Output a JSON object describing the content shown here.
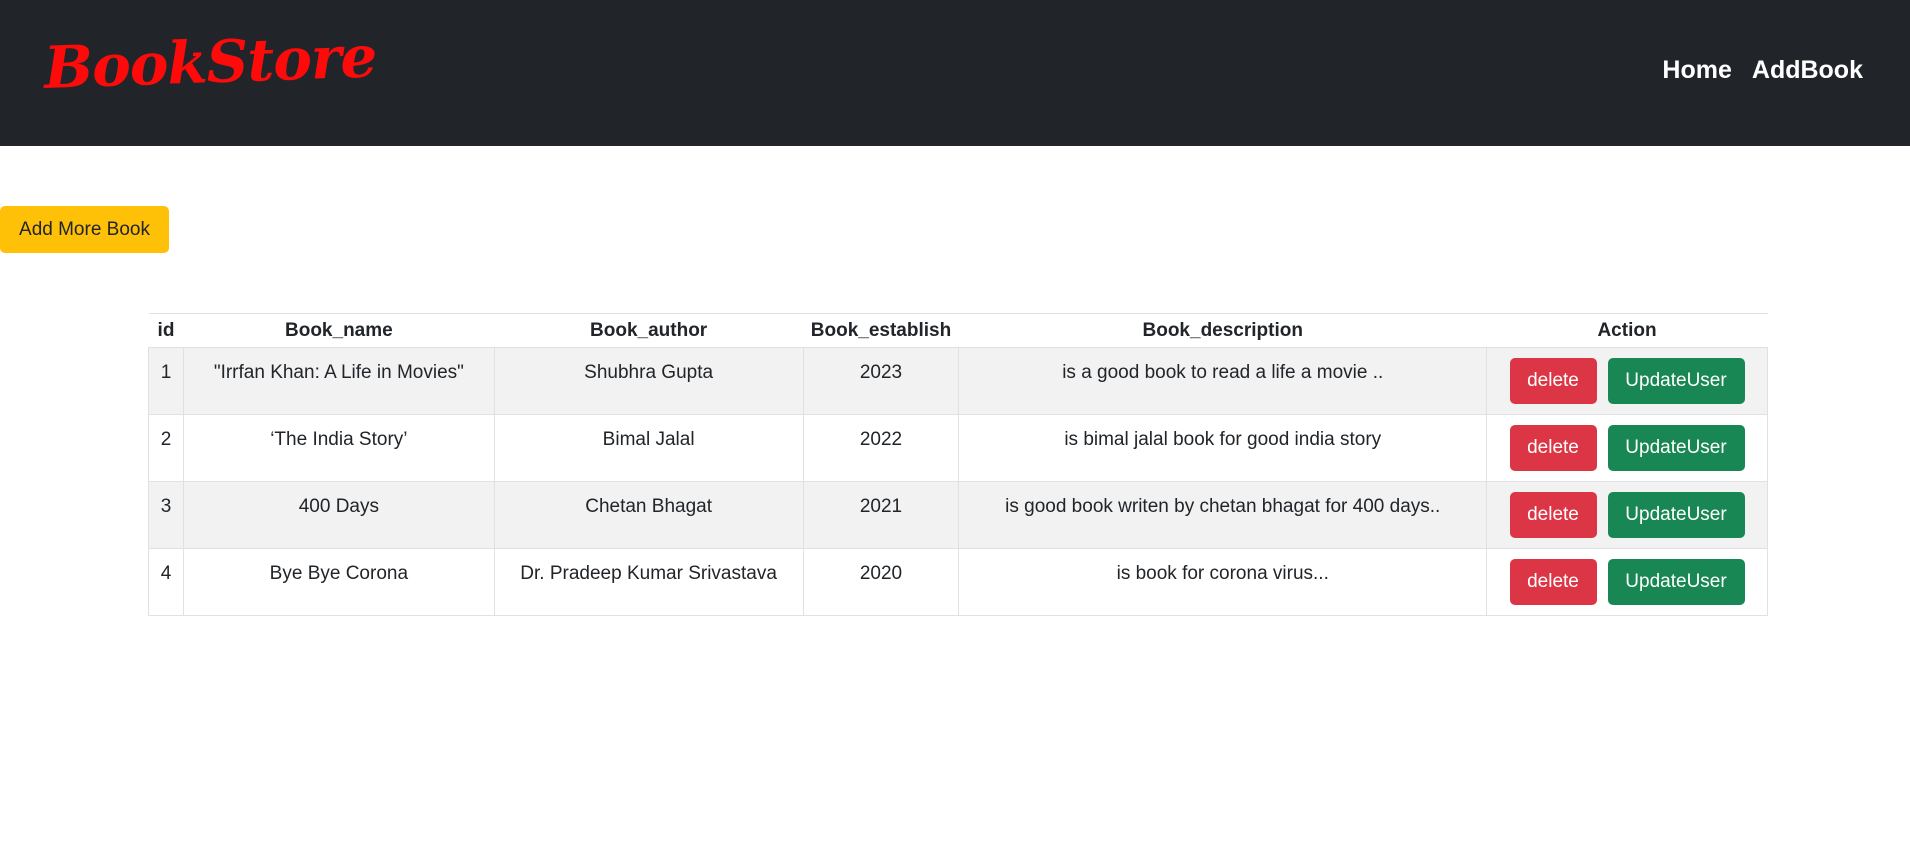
{
  "brand": {
    "name": "BookStore",
    "color": "#ff0a0a"
  },
  "nav": {
    "links": [
      "Home",
      "AddBook"
    ]
  },
  "add_more_button": {
    "label": "Add More Book",
    "color": "#ffc107"
  },
  "table": {
    "headers": [
      "id",
      "Book_name",
      "Book_author",
      "Book_establish",
      "Book_description",
      "Action"
    ],
    "rows": [
      {
        "id": "1",
        "name": "\"Irrfan Khan: A Life in Movies\"",
        "author": "Shubhra Gupta",
        "establish": "2023",
        "description": "is a good book to read a life a movie ..",
        "delete_label": "delete",
        "update_label": "UpdateUser"
      },
      {
        "id": "2",
        "name": "‘The India Story’",
        "author": "Bimal Jalal",
        "establish": "2022",
        "description": "is bimal jalal book for good india story",
        "delete_label": "delete",
        "update_label": "UpdateUser"
      },
      {
        "id": "3",
        "name": "400 Days",
        "author": "Chetan Bhagat",
        "establish": "2021",
        "description": "is good book writen by chetan bhagat for 400 days..",
        "delete_label": "delete",
        "update_label": "UpdateUser"
      },
      {
        "id": "4",
        "name": "Bye Bye Corona",
        "author": "Dr. Pradeep Kumar Srivastava",
        "establish": "2020",
        "description": "is book for corona virus...",
        "delete_label": "delete",
        "update_label": "UpdateUser"
      }
    ]
  },
  "colors": {
    "navbar_bg": "#212529",
    "delete_button": "#dc3545",
    "update_button": "#198754",
    "row_stripe": "#f2f2f2"
  }
}
